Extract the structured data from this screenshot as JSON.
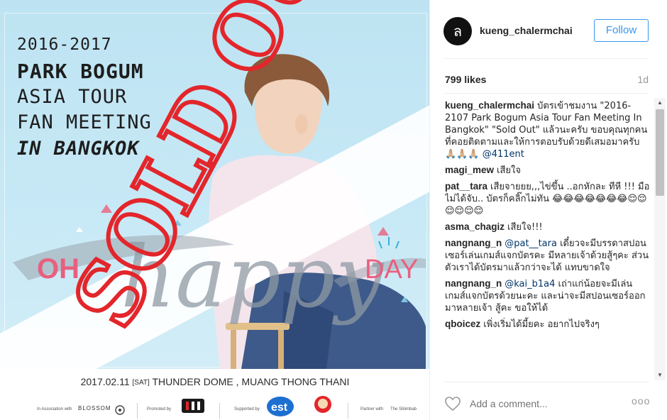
{
  "poster": {
    "years": "2016-2017",
    "name": "PARK BOGUM",
    "line_asia": "ASIA TOUR",
    "line_fan": "FAN MEETING",
    "line_city": "IN BANGKOK",
    "oh": "OH",
    "happy": "happy",
    "day": "DAY",
    "sold_out": "SOLD OUT",
    "event_date": "2017.02.11",
    "event_day": "[SAT]",
    "event_venue": "THUNDER DOME , MUANG THONG THANI",
    "assoc_label": "In Association with",
    "assoc_name": "BLOSSOM",
    "promoted_label": "Promoted by",
    "supported_label": "Supported by",
    "partner_label": "Partner with",
    "partner_name": "The Sibimbab"
  },
  "post": {
    "avatar_glyph": "ล",
    "username": "kueng_chalermchai",
    "follow_label": "Follow",
    "likes": "799 likes",
    "age": "1d",
    "add_comment_placeholder": "Add a comment...",
    "more_label": "ooo"
  },
  "comments": [
    {
      "user": "kueng_chalermchai",
      "text": "บัตรเข้าชมงาน \"2016-2107 Park Bogum Asia Tour Fan Meeting In Bangkok\" \"Sold Out\" แล้วนะครับ ขอบคุณทุกคนที่คอยติดตามและให้การตอบรับด้วยดีเสมอมาครับ 🙏🏼🙏🏼🙏🏼",
      "mention": "@411ent"
    },
    {
      "user": "magi_mew",
      "text": "เสียใจ",
      "mention": ""
    },
    {
      "user": "pat__tara",
      "text": "เสียจายยย,,,ไข่ขึ้น ..อกหักละ ทีหี !!! มือไม่ได้จับ.. บัตรก็คลิ๊กไม่ทัน 😂😂😂😂😂😂😂😌😌😌😌😌😌",
      "mention": ""
    },
    {
      "user": "asma_chagiz",
      "text": "เสียใจ!!!",
      "mention": ""
    },
    {
      "user": "nangnang_n",
      "mention": "@pat__tara",
      "text": "เดี๋ยวจะมีบรรดาสปอนเซอร์เล่นเกมส์แจกบัตรคะ มีหลายเจ้าด้วยสู้ๆคะ ส่วนตัวเราได้บัตรมาแล้วกว่าจะได้ แทบขาดใจ"
    },
    {
      "user": "nangnang_n",
      "mention": "@kai_b1a4",
      "text": "เถ่าแก่น้อยจะมีเล่นเกมส์แจกบัตรด้วยนะคะ และน่าจะมีสปอนเซอร์ออกมาหลายเจ้า สู้คะ ขอให้ได้"
    },
    {
      "user": "qboicez",
      "text": "เพิ่งเริ่มได้มี้ยคะ อยากไปจริงๆ",
      "mention": ""
    }
  ],
  "colors": {
    "accent": "#3897f0",
    "mention": "#003569",
    "sold_out_red": "#e3262b",
    "poster_sky": "#bfe4f3",
    "pink": "#e8607f"
  },
  "icons": {
    "heart": "heart-icon",
    "more": "more-options-icon",
    "scroll_up": "scroll-up-icon",
    "scroll_down": "scroll-down-icon"
  }
}
